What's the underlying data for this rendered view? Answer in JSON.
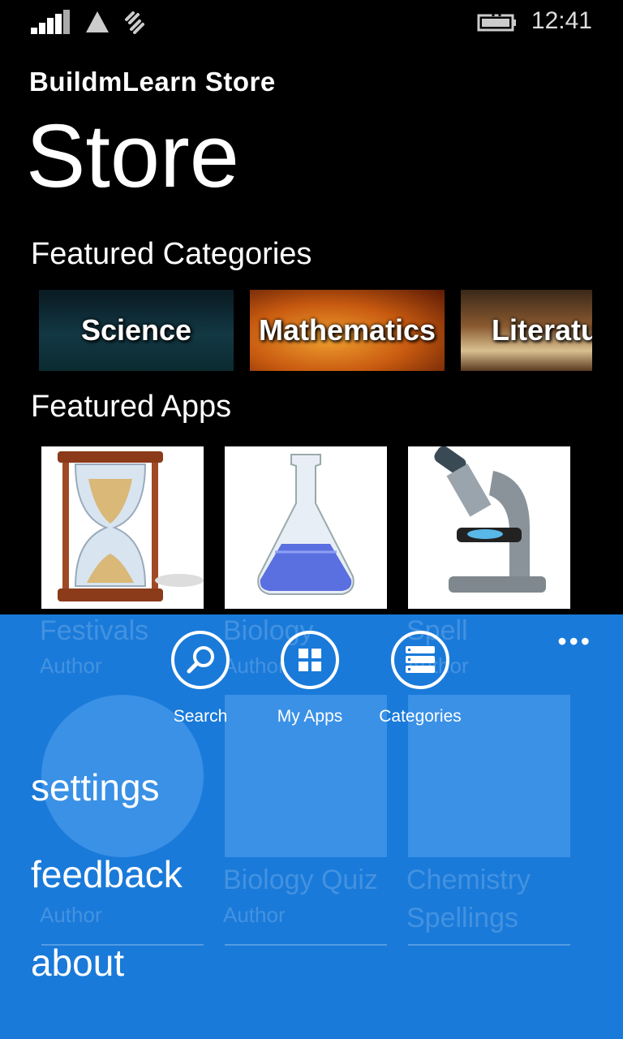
{
  "status_bar": {
    "time": "12:41"
  },
  "header": {
    "app_title": "BuildmLearn Store",
    "page_title": "Store"
  },
  "featured_categories": {
    "title": "Featured Categories",
    "items": [
      {
        "label": "Science"
      },
      {
        "label": "Mathematics"
      },
      {
        "label": "Literatu"
      }
    ]
  },
  "featured_apps": {
    "title": "Featured Apps",
    "row1": [
      {
        "name": "Festivals",
        "author": "Author",
        "icon": "hourglass-icon"
      },
      {
        "name": "Biology",
        "author": "Author",
        "icon": "flask-icon"
      },
      {
        "name": "Spell",
        "author": "Author",
        "icon": "microscope-icon"
      }
    ],
    "row2": [
      {
        "name": "",
        "author": "Author"
      },
      {
        "name": "Biology Quiz",
        "author": "Author"
      },
      {
        "name": "Chemistry",
        "name2": "Spellings"
      }
    ]
  },
  "app_bar": {
    "buttons": [
      {
        "label": "Search",
        "icon": "search-icon"
      },
      {
        "label": "My Apps",
        "icon": "grid-icon"
      },
      {
        "label": "Categories",
        "icon": "list-icon"
      }
    ],
    "menu": [
      {
        "label": "settings"
      },
      {
        "label": "feedback"
      },
      {
        "label": "about"
      }
    ],
    "accent_color": "#1a7ad9"
  }
}
